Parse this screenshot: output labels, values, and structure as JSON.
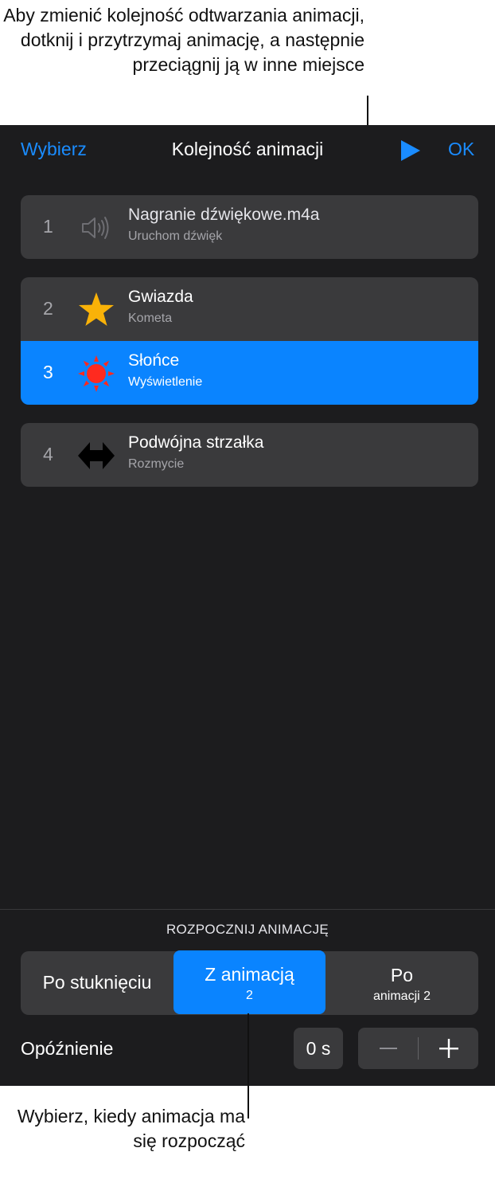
{
  "callouts": {
    "top": "Aby zmienić kolejność odtwarzania animacji, dotknij i przytrzymaj animację, a następnie przeciągnij ją w inne miejsce",
    "bottom": "Wybierz, kiedy animacja ma się rozpocząć"
  },
  "nav": {
    "left_label": "Wybierz",
    "title": "Kolejność animacji",
    "play_icon": "play-icon",
    "right_label": "OK"
  },
  "animations": [
    {
      "number": "1",
      "title": "Nagranie dźwiękowe.m4a",
      "subtitle": "Uruchom dźwięk",
      "icon": "speaker-icon"
    },
    {
      "number": "2",
      "title": "Gwiazda",
      "subtitle": "Kometa",
      "icon": "star-icon"
    },
    {
      "number": "3",
      "title": "Słońce",
      "subtitle": "Wyświetlenie",
      "icon": "sun-icon",
      "selected": true
    },
    {
      "number": "4",
      "title": "Podwójna strzałka",
      "subtitle": "Rozmycie",
      "icon": "double-arrow-icon"
    }
  ],
  "start": {
    "section_label": "ROZPOCZNIJ ANIMACJĘ",
    "options": [
      {
        "label": "Po stuknięciu",
        "sub": ""
      },
      {
        "label": "Z animacją",
        "sub": "2",
        "selected": true
      },
      {
        "label": "Po",
        "sub": "animacji 2"
      }
    ]
  },
  "delay": {
    "label": "Opóźnienie",
    "value": "0 s"
  },
  "colors": {
    "accent": "#0a84ff",
    "panel_bg": "#1c1c1e",
    "row_bg": "#3a3a3c",
    "star": "#f9b208",
    "sun": "#ff2a1f"
  }
}
